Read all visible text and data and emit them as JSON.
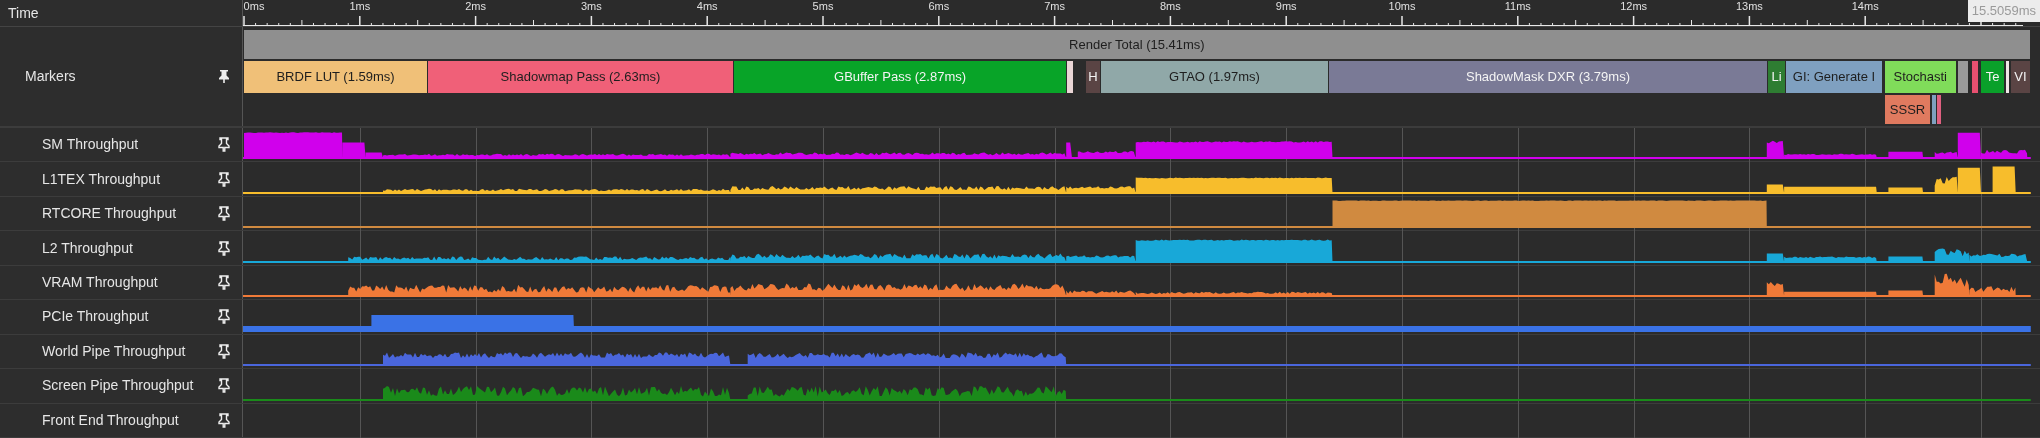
{
  "time_header": {
    "label": "Time",
    "ticks": [
      "0ms",
      "1ms",
      "2ms",
      "3ms",
      "4ms",
      "5ms",
      "6ms",
      "7ms",
      "8ms",
      "9ms",
      "10ms",
      "11ms",
      "12ms",
      "13ms",
      "14ms"
    ],
    "end_time": "15.5059ms"
  },
  "markers": {
    "label": "Markers",
    "lanes": [
      [
        {
          "label": "Render Total (15.41ms)",
          "color": "#8f8f8f"
        }
      ],
      [
        {
          "label": "BRDF LUT (1.59ms)",
          "color": "#f0c078"
        },
        {
          "label": "Shadowmap Pass (2.63ms)",
          "color": "#f06078"
        },
        {
          "label": "GBuffer Pass (2.87ms)",
          "color": "#08a428"
        },
        {
          "color": "#ead6d6"
        },
        {
          "label": "H",
          "color": "#5a4444"
        },
        {
          "label": "GTAO (1.97ms)",
          "color": "#90a8a8"
        },
        {
          "label": "ShadowMask DXR (3.79ms)",
          "color": "#7a7a96"
        },
        {
          "label": "Li",
          "color": "#2e7d32"
        },
        {
          "label": "GI: Generate I",
          "color": "#7fa0c0"
        },
        {
          "label": "Stochasti",
          "color": "#80dc5a"
        },
        {
          "color": "#9a9a9a"
        },
        {
          "color": "#e85070"
        },
        {
          "label": "Te",
          "color": "#0aa02a"
        },
        {
          "color": "#f0e8e8"
        },
        {
          "label": "VI",
          "color": "#5a4444"
        }
      ],
      [
        {
          "label": "SSSR",
          "color": "#e07a5f"
        },
        {
          "color": "#7fa0c0"
        },
        {
          "color": "#e06080"
        }
      ]
    ]
  },
  "tracks": [
    {
      "label": "SM Throughput",
      "color": "#d000ec"
    },
    {
      "label": "L1TEX Throughput",
      "color": "#f7bd2c"
    },
    {
      "label": "RTCORE Throughput",
      "color": "#d08a40"
    },
    {
      "label": "L2 Throughput",
      "color": "#18a8d8"
    },
    {
      "label": "VRAM Throughput",
      "color": "#f07a38"
    },
    {
      "label": "PCIe Throughput",
      "color": "#3a72e6"
    },
    {
      "label": "World Pipe Throughput",
      "color": "#4a66dc"
    },
    {
      "label": "Screen Pipe Throughput",
      "color": "#1a8a1a"
    },
    {
      "label": "Front End Throughput"
    }
  ]
}
